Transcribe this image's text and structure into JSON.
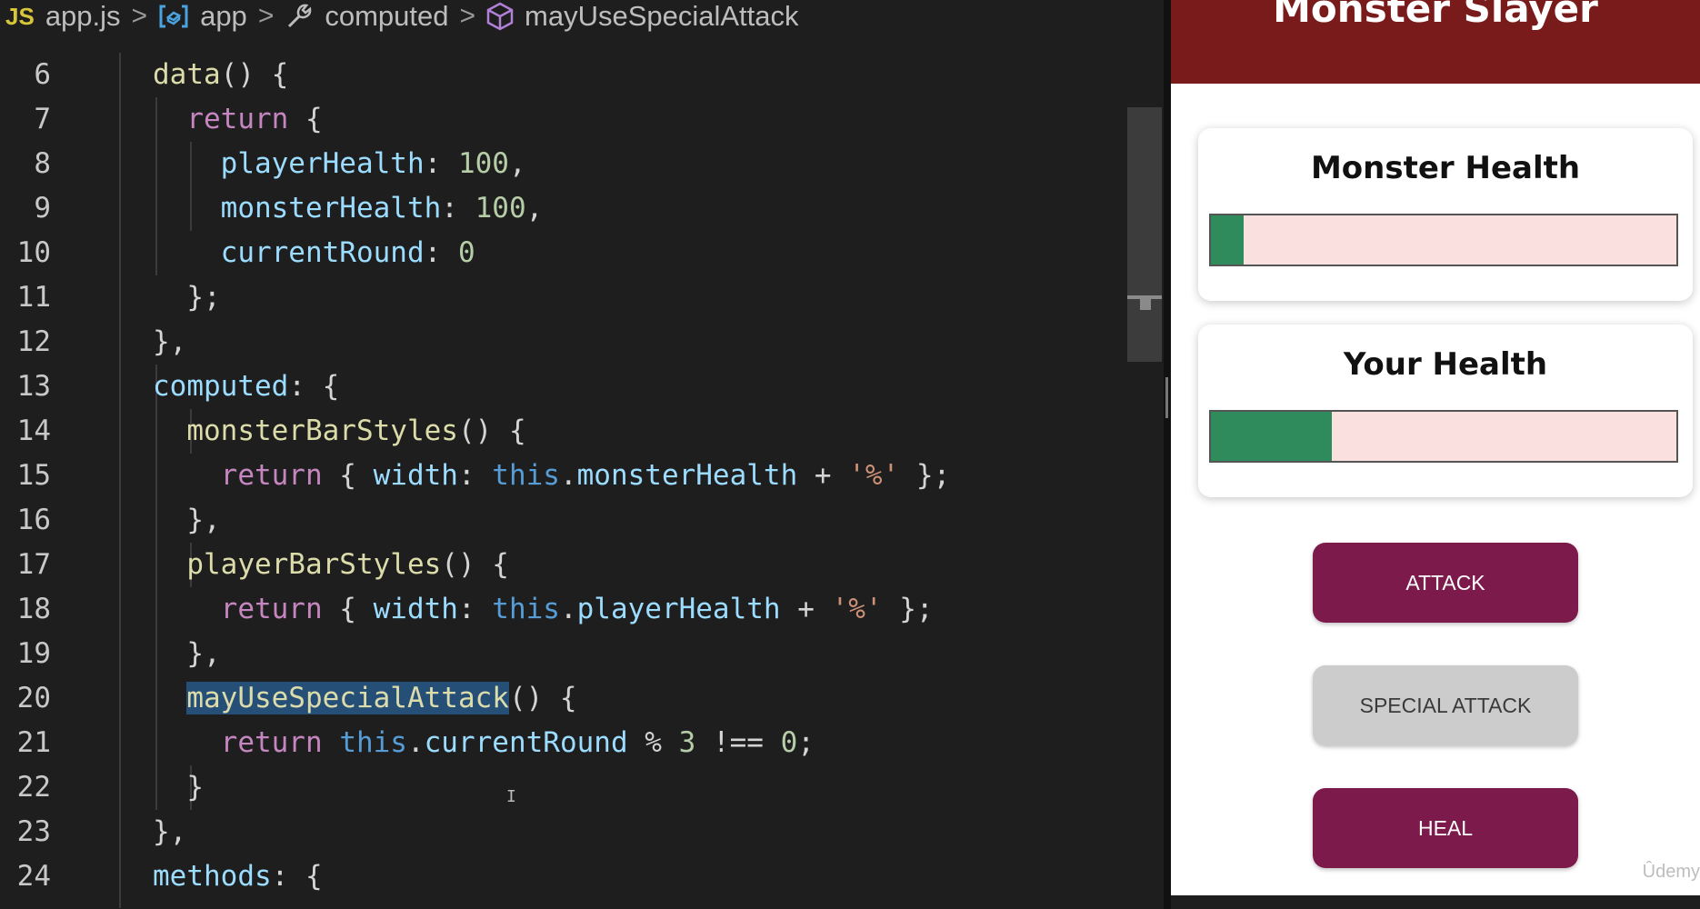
{
  "breadcrumb": {
    "file_icon": "js-file-icon",
    "file": "app.js",
    "separator": ">",
    "items": [
      {
        "label": "app",
        "icon": "variable-icon"
      },
      {
        "label": "computed",
        "icon": "wrench-icon"
      },
      {
        "label": "mayUseSpecialAttack",
        "icon": "cube-icon"
      }
    ]
  },
  "editor": {
    "line_numbers": [
      "6",
      "7",
      "8",
      "9",
      "10",
      "11",
      "12",
      "13",
      "14",
      "15",
      "16",
      "17",
      "18",
      "19",
      "20",
      "21",
      "22",
      "23",
      "24"
    ],
    "selected_token": "mayUseSpecialAttack"
  },
  "preview": {
    "title": "Monster Slayer",
    "monster_health_label": "Monster Health",
    "monster_health_percent": 7,
    "your_health_label": "Your Health",
    "your_health_percent": 26,
    "buttons": {
      "attack": "ATTACK",
      "special_attack": "SPECIAL ATTACK",
      "heal": "HEAL"
    },
    "special_attack_disabled": true,
    "watermark": "Ûdemy"
  },
  "colors": {
    "header": "#7a1b1b",
    "button": "#7d1a4c",
    "bar_fill": "#2f8a5c",
    "bar_background": "#fbe0e0"
  }
}
